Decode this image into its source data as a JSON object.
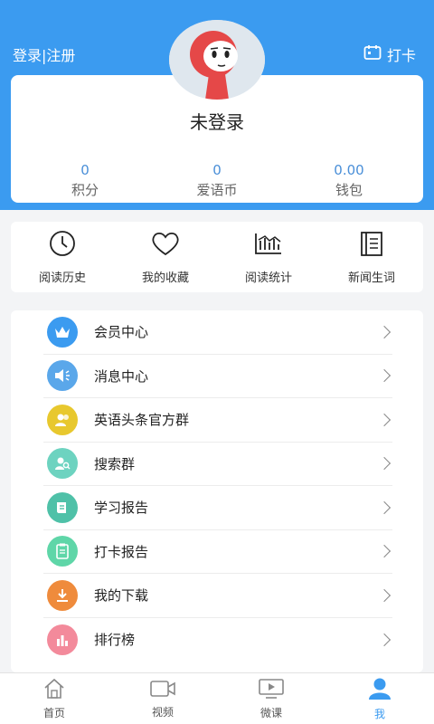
{
  "header": {
    "login_register": "登录|注册",
    "checkin_label": "打卡",
    "accent_color": "#3b9bf0"
  },
  "profile": {
    "username": "未登录",
    "stats": [
      {
        "value": "0",
        "label": "积分"
      },
      {
        "value": "0",
        "label": "爱语币"
      },
      {
        "value": "0.00",
        "label": "钱包"
      }
    ]
  },
  "quick_actions": [
    {
      "label": "阅读历史",
      "icon": "clock-icon"
    },
    {
      "label": "我的收藏",
      "icon": "heart-icon"
    },
    {
      "label": "阅读统计",
      "icon": "chart-icon"
    },
    {
      "label": "新闻生词",
      "icon": "notebook-icon"
    }
  ],
  "menu": [
    {
      "label": "会员中心",
      "icon": "crown-icon",
      "color": "#3b9bf0"
    },
    {
      "label": "消息中心",
      "icon": "speaker-icon",
      "color": "#5aa7ea"
    },
    {
      "label": "英语头条官方群",
      "icon": "group-icon",
      "color": "#e8c82e"
    },
    {
      "label": "搜索群",
      "icon": "search-group-icon",
      "color": "#6dd3c0"
    },
    {
      "label": "学习报告",
      "icon": "report-icon",
      "color": "#4fc1a8"
    },
    {
      "label": "打卡报告",
      "icon": "checkin-report-icon",
      "color": "#5fd6a8"
    },
    {
      "label": "我的下载",
      "icon": "download-icon",
      "color": "#ef8b3c"
    },
    {
      "label": "排行榜",
      "icon": "ranking-icon",
      "color": "#f38a9b"
    }
  ],
  "tabbar": [
    {
      "label": "首页",
      "icon": "home-icon",
      "active": false
    },
    {
      "label": "视频",
      "icon": "video-icon",
      "active": false
    },
    {
      "label": "微课",
      "icon": "play-icon",
      "active": false
    },
    {
      "label": "我",
      "icon": "user-icon",
      "active": true
    }
  ]
}
